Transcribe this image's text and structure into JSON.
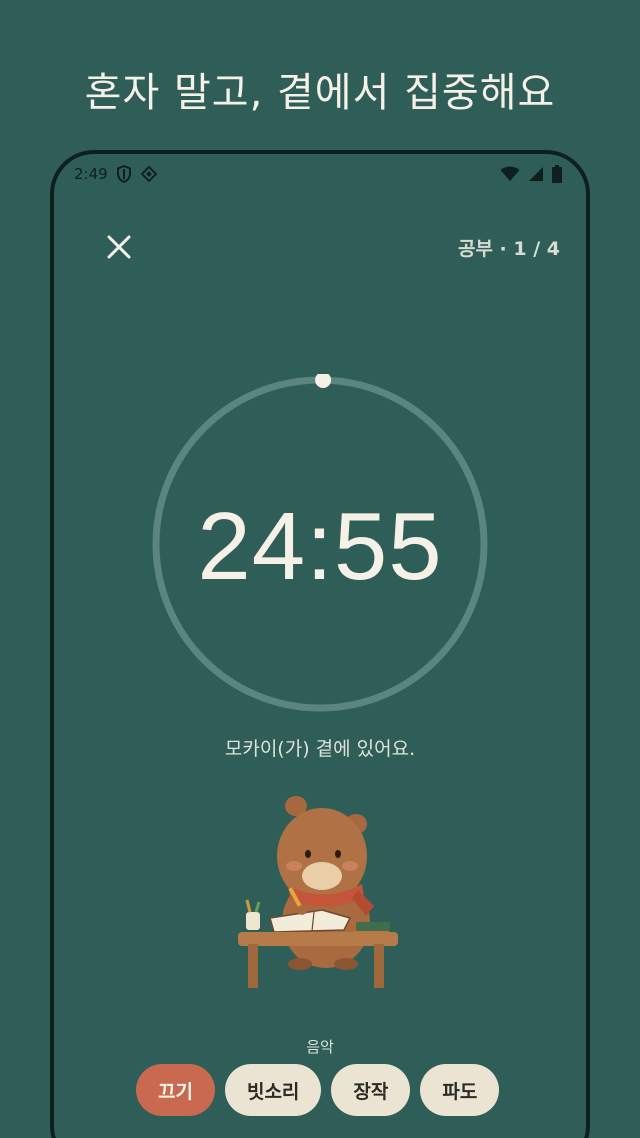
{
  "headline": "혼자 말고, 곁에서 집중해요",
  "status_bar": {
    "time": "2:49",
    "left_icons": [
      "shield-icon",
      "diamond-grid-icon"
    ],
    "right_icons": [
      "wifi-icon",
      "signal-icon",
      "battery-icon"
    ]
  },
  "header": {
    "close_icon": "close-icon",
    "session_label": "공부 · 1 / 4"
  },
  "timer": {
    "display": "24:55",
    "progress_fraction": 0.003
  },
  "companion_text": "모카이(가) 곁에 있어요.",
  "character": "capybara-studying-illustration",
  "music": {
    "label": "음악",
    "options": [
      {
        "label": "끄기",
        "active": true
      },
      {
        "label": "빗소리",
        "active": false
      },
      {
        "label": "장작",
        "active": false
      },
      {
        "label": "파도",
        "active": false
      }
    ]
  },
  "colors": {
    "background": "#2f5e58",
    "text_light": "#f6f1e6",
    "accent": "#c9694f",
    "chip_bg": "#ece4d2",
    "ring_track": "#5b857f"
  }
}
